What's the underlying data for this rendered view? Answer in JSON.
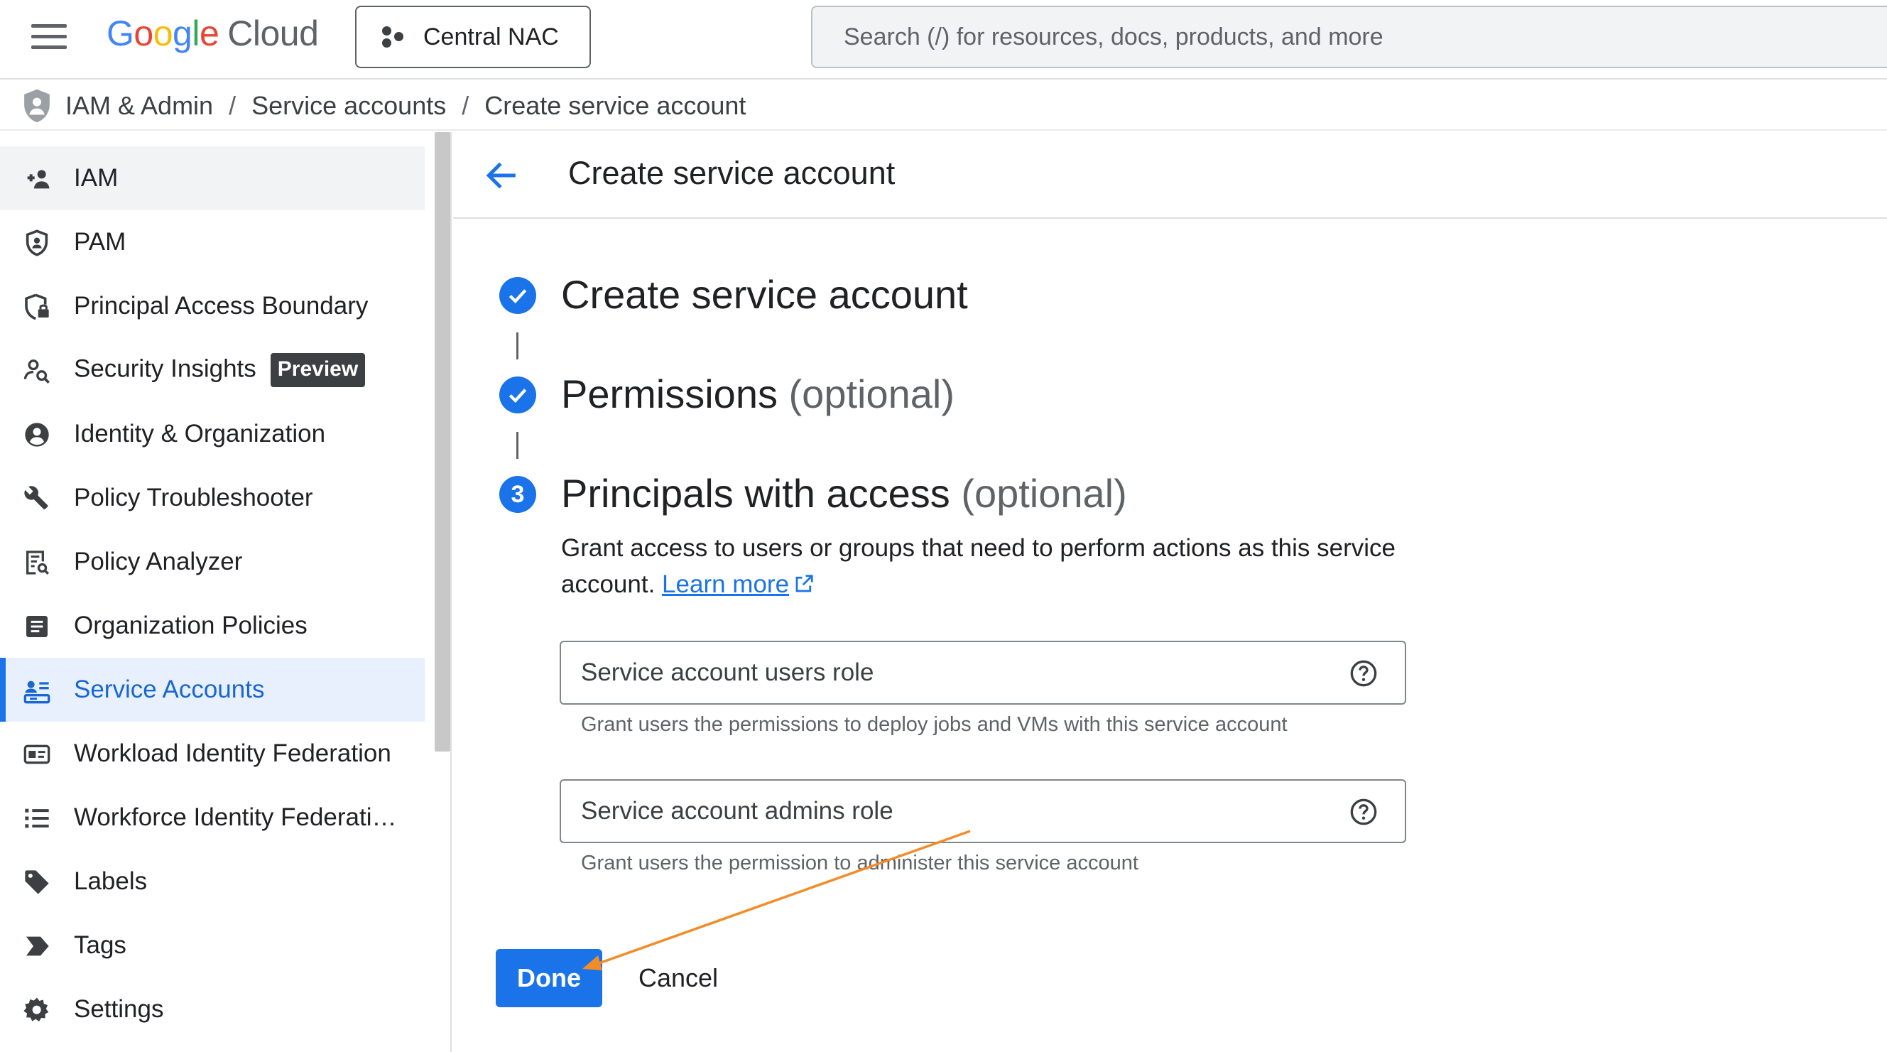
{
  "topbar": {
    "logo_google": [
      "G",
      "o",
      "o",
      "g",
      "l",
      "e"
    ],
    "logo_cloud": "Cloud",
    "project_name": "Central NAC",
    "search_placeholder": "Search (/) for resources, docs, products, and more"
  },
  "breadcrumb": {
    "items": [
      "IAM & Admin",
      "Service accounts",
      "Create service account"
    ],
    "separator": "/"
  },
  "sidebar": {
    "items": [
      {
        "label": "IAM",
        "icon": "person-add-icon",
        "state": "hover"
      },
      {
        "label": "PAM",
        "icon": "shield-person-icon"
      },
      {
        "label": "Principal Access Boundary",
        "icon": "shield-lock-icon"
      },
      {
        "label": "Security Insights",
        "icon": "person-search-icon",
        "badge": "Preview"
      },
      {
        "label": "Identity & Organization",
        "icon": "account-circle-icon"
      },
      {
        "label": "Policy Troubleshooter",
        "icon": "wrench-icon"
      },
      {
        "label": "Policy Analyzer",
        "icon": "document-search-icon"
      },
      {
        "label": "Organization Policies",
        "icon": "list-document-icon"
      },
      {
        "label": "Service Accounts",
        "icon": "service-account-icon",
        "state": "active"
      },
      {
        "label": "Workload Identity Federation",
        "icon": "id-card-icon"
      },
      {
        "label": "Workforce Identity Federati…",
        "icon": "list-icon"
      },
      {
        "label": "Labels",
        "icon": "label-tag-icon"
      },
      {
        "label": "Tags",
        "icon": "tag-chevron-icon"
      },
      {
        "label": "Settings",
        "icon": "gear-icon"
      }
    ]
  },
  "main": {
    "page_title": "Create service account",
    "steps": [
      {
        "title": "Create service account",
        "optional": "",
        "status": "complete"
      },
      {
        "title": "Permissions",
        "optional": "(optional)",
        "status": "complete"
      },
      {
        "title": "Principals with access",
        "optional": "(optional)",
        "status": "current",
        "number": "3"
      }
    ],
    "description": "Grant access to users or groups that need to perform actions as this service account.",
    "learn_more": "Learn more",
    "fields": [
      {
        "placeholder": "Service account users role",
        "hint": "Grant users the permissions to deploy jobs and VMs with this service account"
      },
      {
        "placeholder": "Service account admins role",
        "hint": "Grant users the permission to administer this service account"
      }
    ],
    "done_label": "Done",
    "cancel_label": "Cancel"
  },
  "colors": {
    "accent": "#1a73e8",
    "active_bg": "#e8f0fe",
    "annotation_arrow": "#f28c28"
  }
}
